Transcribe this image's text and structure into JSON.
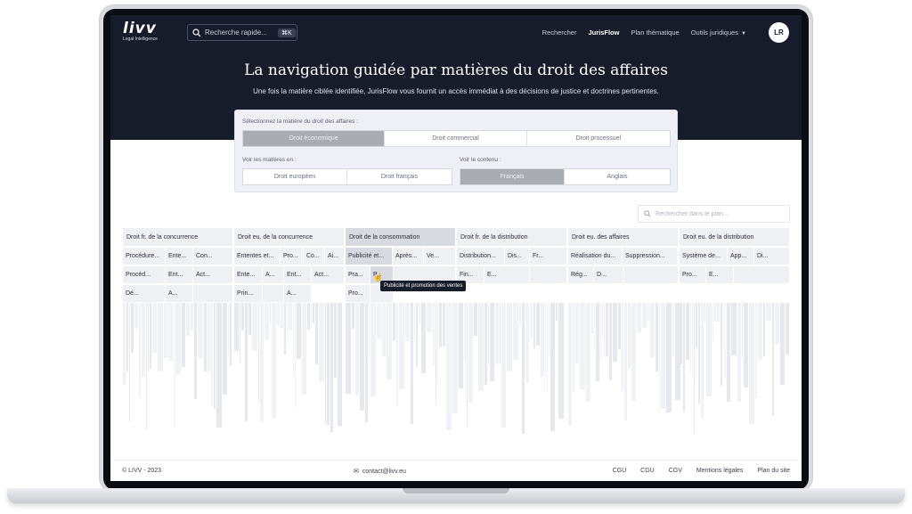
{
  "header": {
    "logo": "livv",
    "logo_sub": "Legal Intelligence",
    "search_placeholder": "Recherche rapide...",
    "shortcut": "⌘K",
    "nav": [
      "Rechercher",
      "JurisFlow",
      "Plan thématique",
      "Outils juridiques"
    ],
    "nav_active": "JurisFlow",
    "avatar": "LR"
  },
  "hero": {
    "title": "La navigation guidée par matières du droit des affaires",
    "subtitle": "Une fois la matière ciblée identifiée, JurisFlow vous fournit un accès immédiat à des décisions de justice et doctrines pertinentes."
  },
  "filters": {
    "matiere_label": "Sélectionnez la matière du droit des affaires :",
    "matiere_options": [
      "Droit économique",
      "Droit commercial",
      "Droit processuel"
    ],
    "matiere_selected": "Droit économique",
    "voir_label": "Voir les matières en :",
    "voir_options": [
      "Droit européen",
      "Droit français"
    ],
    "contenu_label": "Voir le contenu :",
    "contenu_options": [
      "Français",
      "Anglais"
    ],
    "contenu_selected": "Français"
  },
  "plan_search_placeholder": "Rechercher dans le plan...",
  "tree": {
    "columns": [
      {
        "title": "Droit fr. de la concurrence",
        "rows": [
          [
            "Procédure...",
            "Ente...",
            "Con..."
          ],
          [
            "Procéd...",
            "Ent...",
            "Act..."
          ],
          [
            "Dé...",
            "A..."
          ]
        ]
      },
      {
        "title": "Droit eu. de la concurrence",
        "rows": [
          [
            "Ententes et...",
            "Pro...",
            "Co...",
            "Ai..."
          ],
          [
            "Ente...",
            "A...",
            "Ent...",
            "Act..."
          ],
          [
            "Prin...",
            "",
            "A..."
          ]
        ]
      },
      {
        "title": "Droit de la consommation",
        "rows": [
          [
            "Publicité et...",
            "Après...",
            "Ve..."
          ],
          [
            "Pra...",
            "P..."
          ],
          [
            "Pro..."
          ]
        ]
      },
      {
        "title": "Droit fr. de la distribution",
        "rows": [
          [
            "Distribution...",
            "Dis...",
            "Fr..."
          ],
          [
            "Fin...",
            "E..."
          ]
        ]
      },
      {
        "title": "Droit eu. des affaires",
        "rows": [
          [
            "Réalisation du...",
            "Suppression..."
          ],
          [
            "Rég...",
            "D..."
          ]
        ]
      },
      {
        "title": "Droit eu. de la distribution",
        "rows": [
          [
            "Système de...",
            "App...",
            "Di..."
          ],
          [
            "Pro...",
            "E..."
          ]
        ]
      }
    ],
    "tooltip": "Publicité et promotion des ventes"
  },
  "footer": {
    "copyright": "© LIVV - 2023",
    "contact": "contact@livv.eu",
    "links": [
      "CGU",
      "CGU",
      "CGV",
      "Mentions légales",
      "Plan du site"
    ]
  },
  "colors": {
    "header_bg": "#171c2b",
    "selected": "#a9acb3",
    "cell": "#eef0f4"
  }
}
